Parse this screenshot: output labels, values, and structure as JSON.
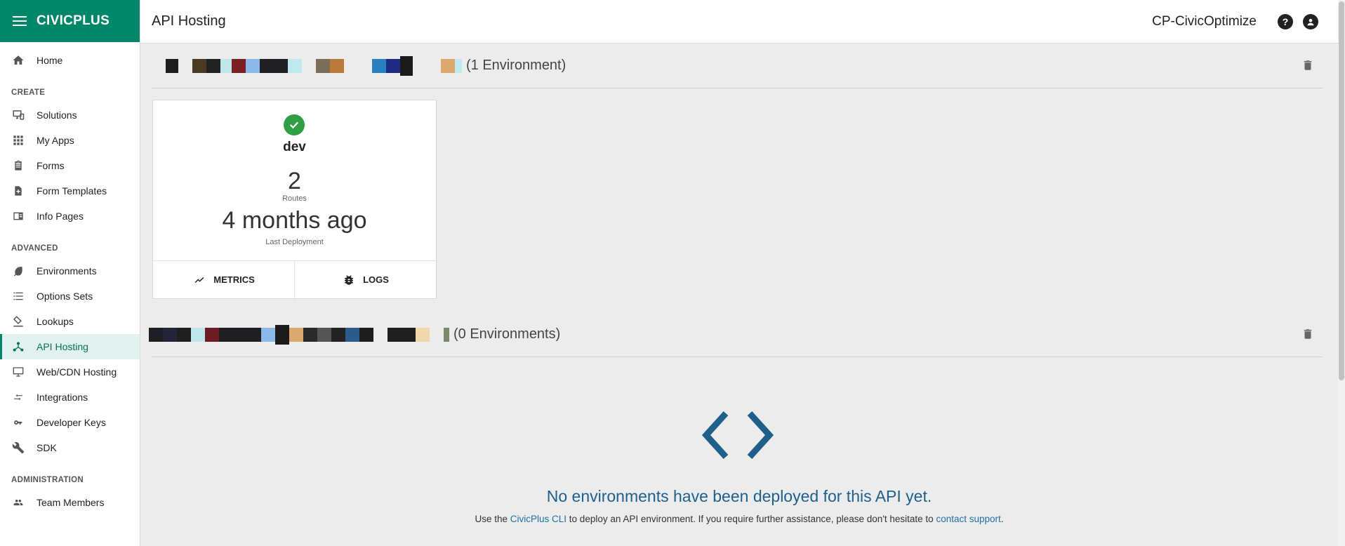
{
  "brand": {
    "name": "CIVICPLUS"
  },
  "header": {
    "title": "API Hosting",
    "org": "CP-CivicOptimize",
    "help_icon": "help-circle-icon",
    "account_icon": "account-circle-icon"
  },
  "sidebar": {
    "home": {
      "label": "Home",
      "icon": "home-icon"
    },
    "sections": [
      {
        "label": "CREATE",
        "items": [
          {
            "label": "Solutions",
            "icon": "solutions-icon"
          },
          {
            "label": "My Apps",
            "icon": "apps-grid-icon"
          },
          {
            "label": "Forms",
            "icon": "clipboard-icon"
          },
          {
            "label": "Form Templates",
            "icon": "file-add-icon"
          },
          {
            "label": "Info Pages",
            "icon": "info-page-icon"
          }
        ]
      },
      {
        "label": "ADVANCED",
        "items": [
          {
            "label": "Environments",
            "icon": "leaf-icon"
          },
          {
            "label": "Options Sets",
            "icon": "list-icon"
          },
          {
            "label": "Lookups",
            "icon": "lookup-icon"
          },
          {
            "label": "API Hosting",
            "icon": "api-hub-icon",
            "active": true
          },
          {
            "label": "Web/CDN Hosting",
            "icon": "monitor-icon"
          },
          {
            "label": "Integrations",
            "icon": "arrows-icon"
          },
          {
            "label": "Developer Keys",
            "icon": "key-icon"
          },
          {
            "label": "SDK",
            "icon": "wrench-icon"
          }
        ]
      },
      {
        "label": "ADMINISTRATION",
        "items": [
          {
            "label": "Team Members",
            "icon": "people-icon"
          }
        ]
      }
    ]
  },
  "apis": [
    {
      "env_count": "(1 Environment)"
    },
    {
      "env_count": "(0 Environments)"
    }
  ],
  "env_card": {
    "name": "dev",
    "route_count": "2",
    "route_label": "Routes",
    "deploy_time": "4 months ago",
    "deploy_label": "Last Deployment",
    "metrics_label": "METRICS",
    "logs_label": "LOGS",
    "status_icon": "check-circle-icon"
  },
  "empty_state": {
    "title": "No environments have been deployed for this API yet.",
    "desc_prefix": "Use the ",
    "cli_link": "CivicPlus CLI",
    "desc_middle": " to deploy an API environment. If you require further assistance, please don't hesitate to ",
    "support_link": "contact support",
    "desc_suffix": ".",
    "icon": "code-brackets-icon"
  },
  "colors": {
    "brand": "#00876a",
    "link": "#1f6fa6",
    "empty_title": "#1f5f8b",
    "success": "#2f9e44"
  }
}
